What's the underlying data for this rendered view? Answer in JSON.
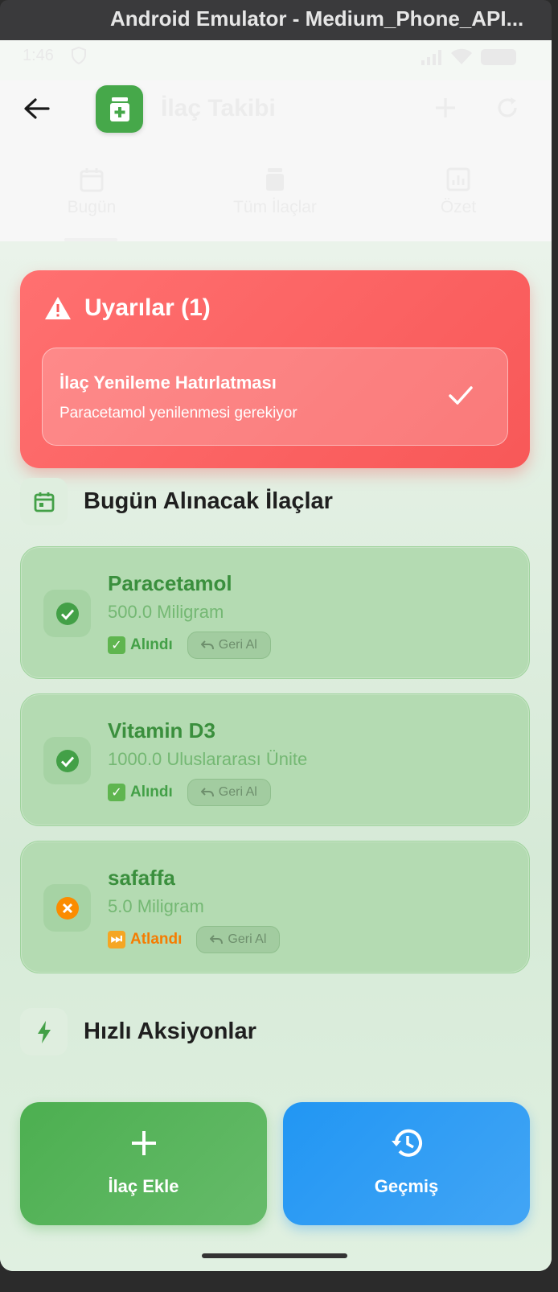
{
  "window": {
    "title": "Android Emulator - Medium_Phone_API..."
  },
  "status_bar": {
    "time": "1:46"
  },
  "app_bar": {
    "title": "İlaç Takibi",
    "back_icon": "arrow-back-icon",
    "add_icon": "add-icon",
    "refresh_icon": "refresh-icon"
  },
  "tabs": [
    {
      "label": "Bugün",
      "icon": "calendar-icon",
      "selected": true
    },
    {
      "label": "Tüm İlaçlar",
      "icon": "medication-icon",
      "selected": false
    },
    {
      "label": "Özet",
      "icon": "analytics-icon",
      "selected": false
    }
  ],
  "alerts": {
    "title": "Uyarılar (1)",
    "items": [
      {
        "title": "İlaç Yenileme Hatırlatması",
        "subtitle": "Paracetamol yenilenmesi gerekiyor"
      }
    ]
  },
  "today": {
    "title": "Bugün Alınacak İlaçlar",
    "meds": [
      {
        "name": "Paracetamol",
        "dose": "500.0 Miligram",
        "status": "Alındı",
        "status_color": "#43a047",
        "undo": "Geri Al"
      },
      {
        "name": "Vitamin D3",
        "dose": "1000.0 Uluslararası Ünite",
        "status": "Alındı",
        "status_color": "#43a047",
        "undo": "Geri Al"
      },
      {
        "name": "safaffa",
        "dose": "5.0 Miligram",
        "status": "Atlandı",
        "status_color": "#f57c00",
        "undo": "Geri Al"
      }
    ]
  },
  "quick_actions": {
    "title": "Hızlı Aksiyonlar",
    "add_label": "İlaç Ekle",
    "history_label": "Geçmiş"
  },
  "colors": {
    "primary_green": "#4caf50",
    "alert_red": "#f85858",
    "history_blue": "#2196f3"
  }
}
